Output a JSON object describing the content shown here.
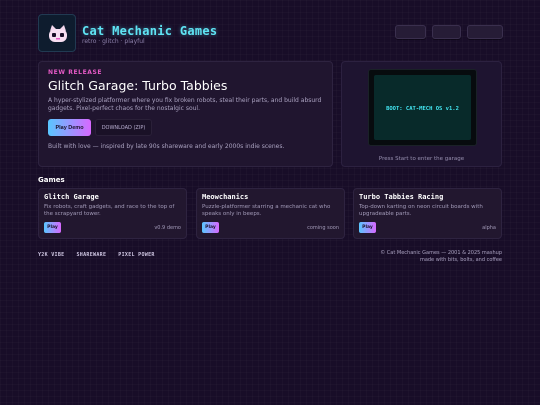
{
  "header": {
    "title": "Cat Mechanic Games",
    "tagline": "retro · glitch · playful",
    "logo_icon": "cat-mascot-icon",
    "nav_items": [
      {
        "label": "",
        "width": 31
      },
      {
        "label": "",
        "width": 29
      },
      {
        "label": "",
        "width": 36
      }
    ]
  },
  "hero": {
    "kicker": "NEW RELEASE",
    "title": "Glitch Garage: Turbo Tabbies",
    "description": "A hyper-stylized platformer where you fix broken robots, steal their parts, and build absurd gadgets. Pixel-perfect chaos for the nostalgic soul.",
    "play_label": "Play Demo",
    "download_label": "DOWNLOAD (ZIP)",
    "footnote": "Built with love — inspired by late 90s shareware and early 2000s indie scenes."
  },
  "terminal": {
    "boot_text": "BOOT: CAT-MECH OS v1.2",
    "caption": "Press Start to enter the garage"
  },
  "games": {
    "section_title": "Games",
    "items": [
      {
        "name": "Glitch Garage",
        "description": "Fix robots, craft gadgets, and race to the top of the scrapyard tower.",
        "play_label": "Play",
        "status": "v0.9 demo"
      },
      {
        "name": "Meowchanics",
        "description": "Puzzle-platformer starring a mechanic cat who speaks only in beeps.",
        "play_label": "Play",
        "status": "coming soon"
      },
      {
        "name": "Turbo Tabbies Racing",
        "description": "Top-down karting on neon circuit boards with upgradeable parts.",
        "play_label": "Play",
        "status": "alpha"
      }
    ]
  },
  "footer": {
    "badges": [
      "Y2K VIBE",
      "SHAREWARE",
      "PIXEL POWER"
    ],
    "copyright": "© Cat Mechanic Games — 2001 & 2025 mashup",
    "credit": "made with bits, bolts, and coffee"
  },
  "colors": {
    "background": "#180d28",
    "accent_cyan": "#5fe4f4",
    "accent_pink": "#e65ac6",
    "button_gradient_start": "#59c6ff",
    "button_gradient_end": "#d768ff"
  }
}
